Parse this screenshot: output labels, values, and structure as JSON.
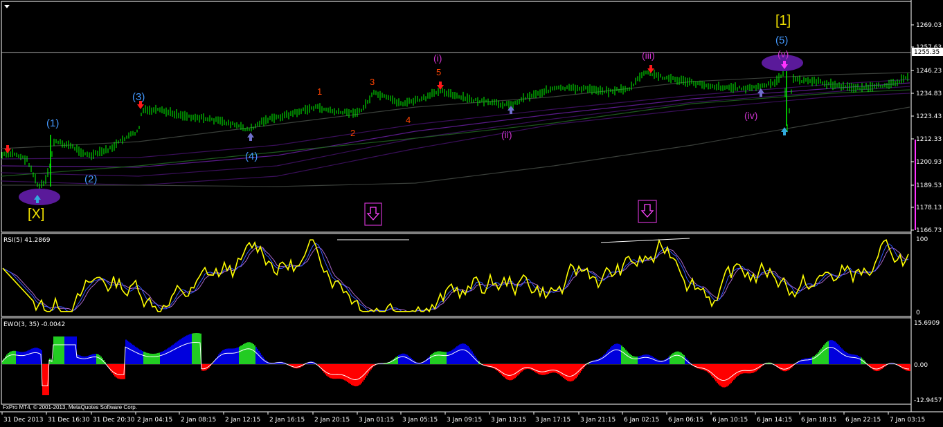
{
  "terminal": {
    "copyright": "FxPro MT4, © 2001-2013, MetaQuotes Software Corp.",
    "panel_separator_color": "#ffffff",
    "background": "#000000"
  },
  "main_chart": {
    "price_labels": [
      "1269.03",
      "1257.63",
      "1255.35",
      "1246.23",
      "1234.83",
      "1223.43",
      "1212.33",
      "1200.93",
      "1189.53",
      "1178.13",
      "1166.73"
    ],
    "current_price_tag": "1255.35",
    "wave_labels": {
      "x_major": "[X]",
      "one_major": "[1]",
      "w1": "(1)",
      "w2": "(2)",
      "w3": "(3)",
      "w4": "(4)",
      "w5": "(5)",
      "s1": "1",
      "s2": "2",
      "s3": "3",
      "s4": "4",
      "s5": "5",
      "i": "(i)",
      "ii": "(ii)",
      "iii": "(iii)",
      "iv": "(iv)",
      "v": "(v)"
    },
    "colors": {
      "candles": "#00ff00",
      "envelope": "#3a0f5a",
      "envelope_mid": "#5a1a8a",
      "ma_slow": "#1e5a1e",
      "ma_grey": "#3a3f3a",
      "major_label": "#f0e000",
      "minor_blue": "#4499ff",
      "sub_red": "#ff4400",
      "sub_magenta": "#cc33cc",
      "ellipse": "#5a1a9a",
      "arrow_red": "#ff1a1a",
      "arrow_blue": "#33aadd",
      "arrow_purple": "#7070cc",
      "arrow_magenta": "#ff33ff",
      "box": "#cc33cc"
    },
    "icons": [
      "down-arrow-box-icon",
      "down-arrow-box-icon",
      "chart-menu-triangle-icon"
    ]
  },
  "rsi_panel": {
    "title": "RSI(5) 41.2869",
    "scale_top": "100",
    "scale_bottom": "0",
    "colors": {
      "line": "#ffff00",
      "band_blue": "#3355ff",
      "band_purple": "#aa66cc",
      "over": "#33ff33",
      "under": "#ff2222",
      "trendline": "#ffffff"
    }
  },
  "ewo_panel": {
    "title": "EWO(3, 35) -0.0042",
    "scale_top": "15.6909",
    "scale_mid": "0.00",
    "scale_bottom": "-12.9457",
    "colors": {
      "positive_blue": "#0000dd",
      "positive_green": "#22cc22",
      "negative": "#ff0000",
      "signal": "#ffffff"
    }
  },
  "time_axis": {
    "labels": [
      "31 Dec 2013",
      "31 Dec 16:30",
      "31 Dec 20:30",
      "2 Jan 04:15",
      "2 Jan 08:15",
      "2 Jan 12:15",
      "2 Jan 16:15",
      "2 Jan 20:15",
      "3 Jan 01:15",
      "3 Jan 05:15",
      "3 Jan 09:15",
      "3 Jan 13:15",
      "3 Jan 17:15",
      "3 Jan 21:15",
      "6 Jan 02:15",
      "6 Jan 06:15",
      "6 Jan 10:15",
      "6 Jan 14:15",
      "6 Jan 18:15",
      "6 Jan 22:15",
      "7 Jan 03:15"
    ]
  }
}
